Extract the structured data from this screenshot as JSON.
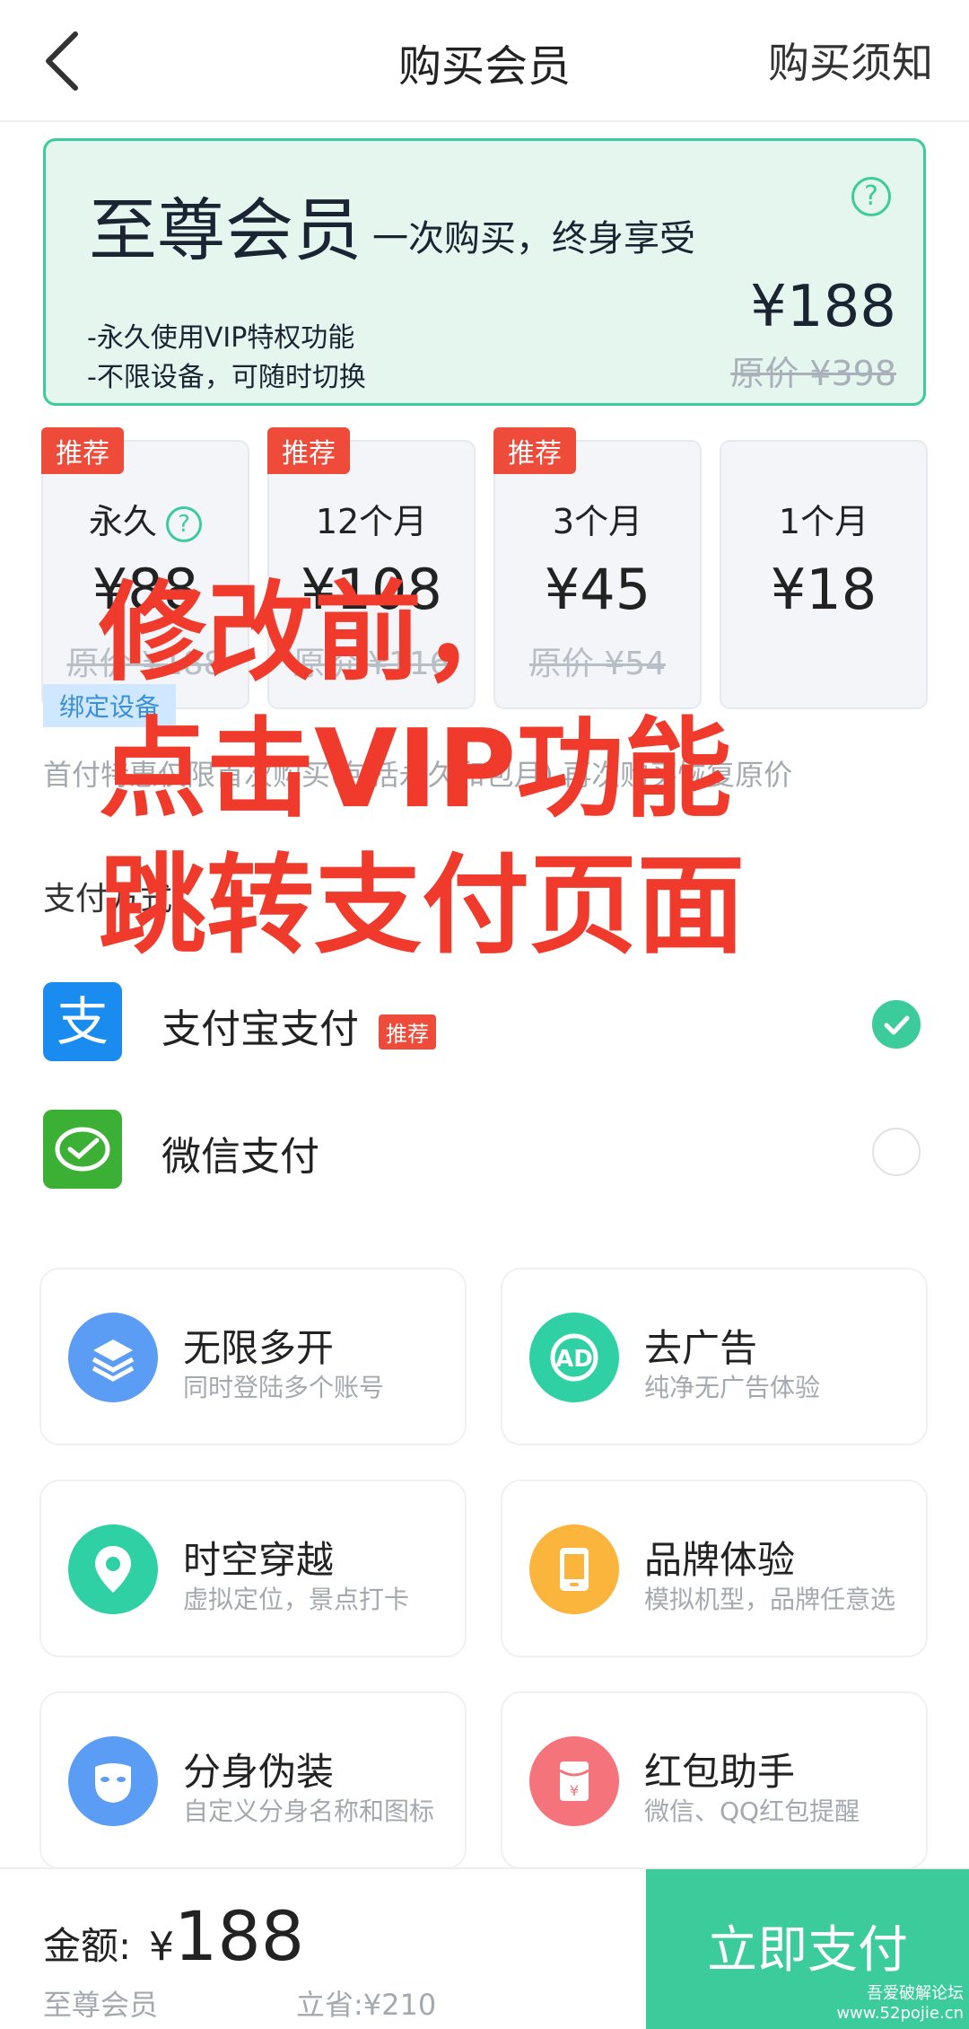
{
  "header": {
    "title": "购买会员",
    "notice": "购买须知"
  },
  "premium": {
    "name": "至尊会员",
    "slogan": "一次购买，终身享受",
    "help": "?",
    "features": [
      "-永久使用VIP特权功能",
      "-不限设备，可随时切换"
    ],
    "price": "¥188",
    "original": "原价 ¥398"
  },
  "plans": [
    {
      "badge": "推荐",
      "duration": "永久",
      "price": "¥88",
      "original": "原价 ¥188",
      "tag": "绑定设备"
    },
    {
      "badge": "推荐",
      "duration": "12个月",
      "price": "¥108",
      "original": "原价 ¥116"
    },
    {
      "badge": "推荐",
      "duration": "3个月",
      "price": "¥45",
      "original": "原价 ¥54"
    },
    {
      "badge": "",
      "duration": "1个月",
      "price": "¥18",
      "original": ""
    }
  ],
  "tip": "首付特惠仅限首次购买(包括永久和包月),再次购买恢复原价",
  "payment": {
    "label": "支付方式",
    "methods": [
      {
        "name": "支付宝支付",
        "badge": "推荐",
        "selected": true,
        "icon": "alipay-icon"
      },
      {
        "name": "微信支付",
        "badge": "",
        "selected": false,
        "icon": "wechat-pay-icon"
      }
    ]
  },
  "features": [
    {
      "title": "无限多开",
      "subtitle": "同时登陆多个账号",
      "icon": "layers-icon",
      "color": "#5b9df5"
    },
    {
      "title": "去广告",
      "subtitle": "纯净无广告体验",
      "icon": "ad-icon",
      "color": "#2fd0a4"
    },
    {
      "title": "时空穿越",
      "subtitle": "虚拟定位，景点打卡",
      "icon": "location-icon",
      "color": "#2fd0a4"
    },
    {
      "title": "品牌体验",
      "subtitle": "模拟机型，品牌任意选",
      "icon": "phone-icon",
      "color": "#fbb43c"
    },
    {
      "title": "分身伪装",
      "subtitle": "自定义分身名称和图标",
      "icon": "mask-icon",
      "color": "#5b9df5"
    },
    {
      "title": "红包助手",
      "subtitle": "微信、QQ红包提醒",
      "icon": "red-packet-icon",
      "color": "#f5737a"
    }
  ],
  "overlay": [
    "修改前，",
    "点击VIP功能",
    "跳转支付页面"
  ],
  "bottom": {
    "amount_label": "金额:",
    "currency": "¥",
    "amount": "188",
    "plan": "至尊会员",
    "saved": "立省:¥210",
    "pay_button": "立即支付",
    "forum1": "吾爱破解论坛",
    "forum2": "www.52pojie.cn"
  }
}
